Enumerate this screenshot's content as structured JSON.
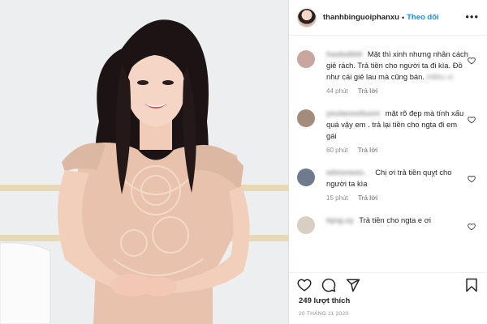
{
  "post": {
    "username": "thanhbinguoiphanxu",
    "separator": "•",
    "follow_label": "Theo dõi",
    "more_label": "•••",
    "likes": "249 lượt thích",
    "date": "20 THÁNG 11 2020"
  },
  "comments": [
    {
      "user": "haobalbbl",
      "text": "Mặt thì xinh nhưng nhân cách giẻ rách. Trả tiền cho người ta đi kìa. Đồ như cái giẻ lau mà cũng bán.",
      "trailing": "#điêu xl",
      "time": "44 phút",
      "reply": "Trả lời",
      "avatar_color": "#c9a7a0"
    },
    {
      "user": "yeulanxoituoni",
      "text": "mặt rõ đẹp mà tính xấu quá vậy em . trả lại tiền cho ngta đi em gái",
      "trailing": "",
      "time": "60 phút",
      "reply": "Trả lời",
      "avatar_color": "#a48c7c"
    },
    {
      "user": "wiinoneeo._",
      "text": "Chị ơi trả tiền quỵt cho người ta kìa",
      "trailing": "",
      "time": "15 phút",
      "reply": "Trả lời",
      "avatar_color": "#6f7a8e"
    },
    {
      "user": "tqng.uy",
      "text": "Trả tiền cho ngta e ơi",
      "trailing": "",
      "time": "",
      "reply": "",
      "avatar_color": "#d8cfc2"
    }
  ],
  "icons": {
    "like": "heart-icon",
    "comment": "comment-icon",
    "share": "share-icon",
    "save": "bookmark-icon",
    "comment_like": "heart-icon"
  }
}
